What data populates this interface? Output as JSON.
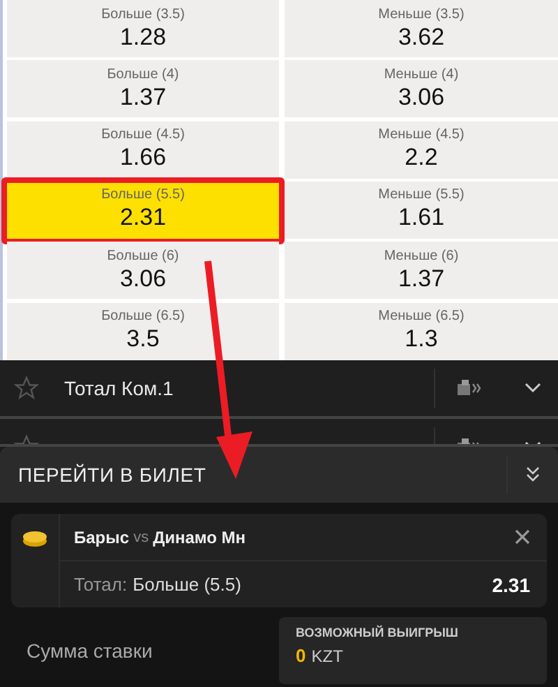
{
  "odds": [
    {
      "over": {
        "label": "Больше (3.5)",
        "value": "1.28",
        "selected": false
      },
      "under": {
        "label": "Меньше (3.5)",
        "value": "3.62",
        "selected": false
      }
    },
    {
      "over": {
        "label": "Больше (4)",
        "value": "1.37",
        "selected": false
      },
      "under": {
        "label": "Меньше (4)",
        "value": "3.06",
        "selected": false
      }
    },
    {
      "over": {
        "label": "Больше (4.5)",
        "value": "1.66",
        "selected": false
      },
      "under": {
        "label": "Меньше (4.5)",
        "value": "2.2",
        "selected": false
      }
    },
    {
      "over": {
        "label": "Больше (5.5)",
        "value": "2.31",
        "selected": true
      },
      "under": {
        "label": "Меньше (5.5)",
        "value": "1.61",
        "selected": false
      }
    },
    {
      "over": {
        "label": "Больше (6)",
        "value": "3.06",
        "selected": false
      },
      "under": {
        "label": "Меньше (6)",
        "value": "1.37",
        "selected": false
      }
    },
    {
      "over": {
        "label": "Больше (6.5)",
        "value": "3.5",
        "selected": false
      },
      "under": {
        "label": "Меньше (6.5)",
        "value": "1.3",
        "selected": false
      }
    }
  ],
  "markets": [
    {
      "title": "Тотал Ком.1",
      "covered": false
    },
    {
      "covered": true
    }
  ],
  "bet_slip": {
    "title": "ПЕРЕЙТИ В БИЛЕТ",
    "bet": {
      "home": "Барыс",
      "separator": "vs",
      "away": "Динамо Мн",
      "market": "Тотал:",
      "selection": "Больше (5.5)",
      "odds": "2.31"
    },
    "stake_label": "Сумма ставки",
    "payout": {
      "label": "ВОЗМОЖНЫЙ ВЫИГРЫШ",
      "amount": "0",
      "currency": "KZT"
    }
  }
}
